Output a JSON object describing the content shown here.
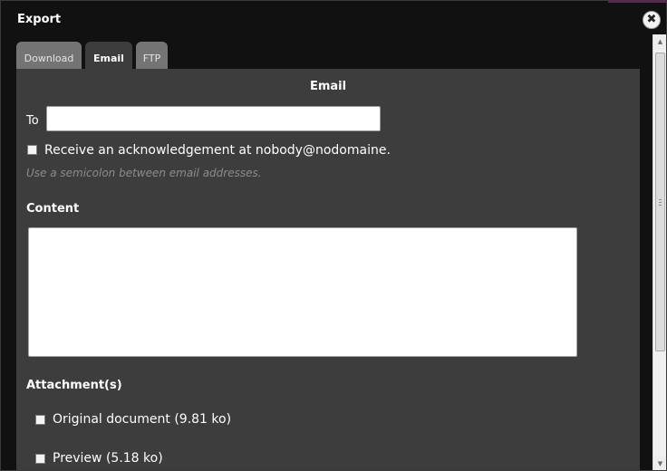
{
  "dialog": {
    "title": "Export",
    "close_symbol": "✖"
  },
  "tabs": [
    {
      "label": "Download",
      "active": false
    },
    {
      "label": "Email",
      "active": true
    },
    {
      "label": "FTP",
      "active": false
    }
  ],
  "email": {
    "heading": "Email",
    "to_label": "To",
    "to_value": "",
    "ack_checked": false,
    "ack_label": "Receive an acknowledgement at nobody@nodomaine.",
    "hint": "Use a semicolon between email addresses.",
    "content_label": "Content",
    "content_value": "",
    "attachments_label": "Attachment(s)",
    "attachments": [
      {
        "label": "Original document (9.81 ko)",
        "checked": false
      },
      {
        "label": "Preview (5.18 ko)",
        "checked": false
      }
    ]
  },
  "scrollbar": {
    "up_symbol": "▲",
    "down_symbol": "▼"
  }
}
